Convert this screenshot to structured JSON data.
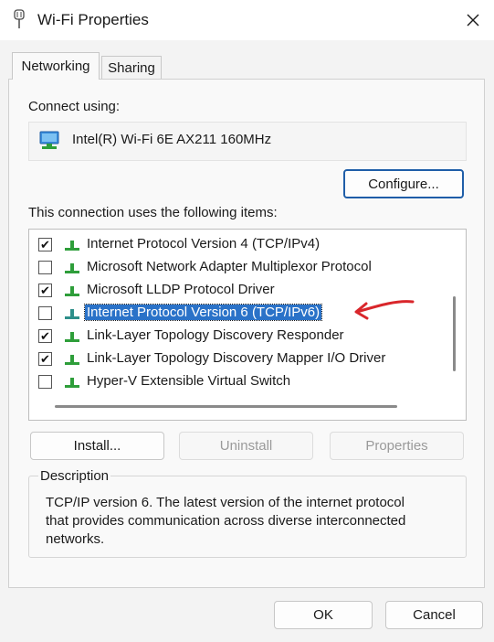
{
  "window": {
    "title": "Wi-Fi Properties"
  },
  "tabs": [
    {
      "label": "Networking",
      "active": true
    },
    {
      "label": "Sharing",
      "active": false
    }
  ],
  "connect_using": {
    "label": "Connect using:",
    "adapter": "Intel(R) Wi-Fi 6E AX211 160MHz",
    "adapter_icon": "network-adapter-icon"
  },
  "buttons": {
    "configure": "Configure...",
    "install": "Install...",
    "uninstall": "Uninstall",
    "properties": "Properties",
    "ok": "OK",
    "cancel": "Cancel"
  },
  "items_label": "This connection uses the following items:",
  "items": [
    {
      "label": "Internet Protocol Version 4 (TCP/IPv4)",
      "checked": true,
      "selected": false
    },
    {
      "label": "Microsoft Network Adapter Multiplexor Protocol",
      "checked": false,
      "selected": false
    },
    {
      "label": "Microsoft LLDP Protocol Driver",
      "checked": true,
      "selected": false
    },
    {
      "label": "Internet Protocol Version 6 (TCP/IPv6)",
      "checked": false,
      "selected": true
    },
    {
      "label": "Link-Layer Topology Discovery Responder",
      "checked": true,
      "selected": false
    },
    {
      "label": "Link-Layer Topology Discovery Mapper I/O Driver",
      "checked": true,
      "selected": false
    },
    {
      "label": "Hyper-V Extensible Virtual Switch",
      "checked": false,
      "selected": false
    }
  ],
  "description": {
    "legend": "Description",
    "line1": "TCP/IP version 6. The latest version of the internet protocol",
    "line2": "that provides communication across diverse interconnected",
    "line3": "networks."
  },
  "colors": {
    "selection": "#2a72c8",
    "annotation": "#d9262b",
    "protocol_icon": "#2e9e3a"
  }
}
